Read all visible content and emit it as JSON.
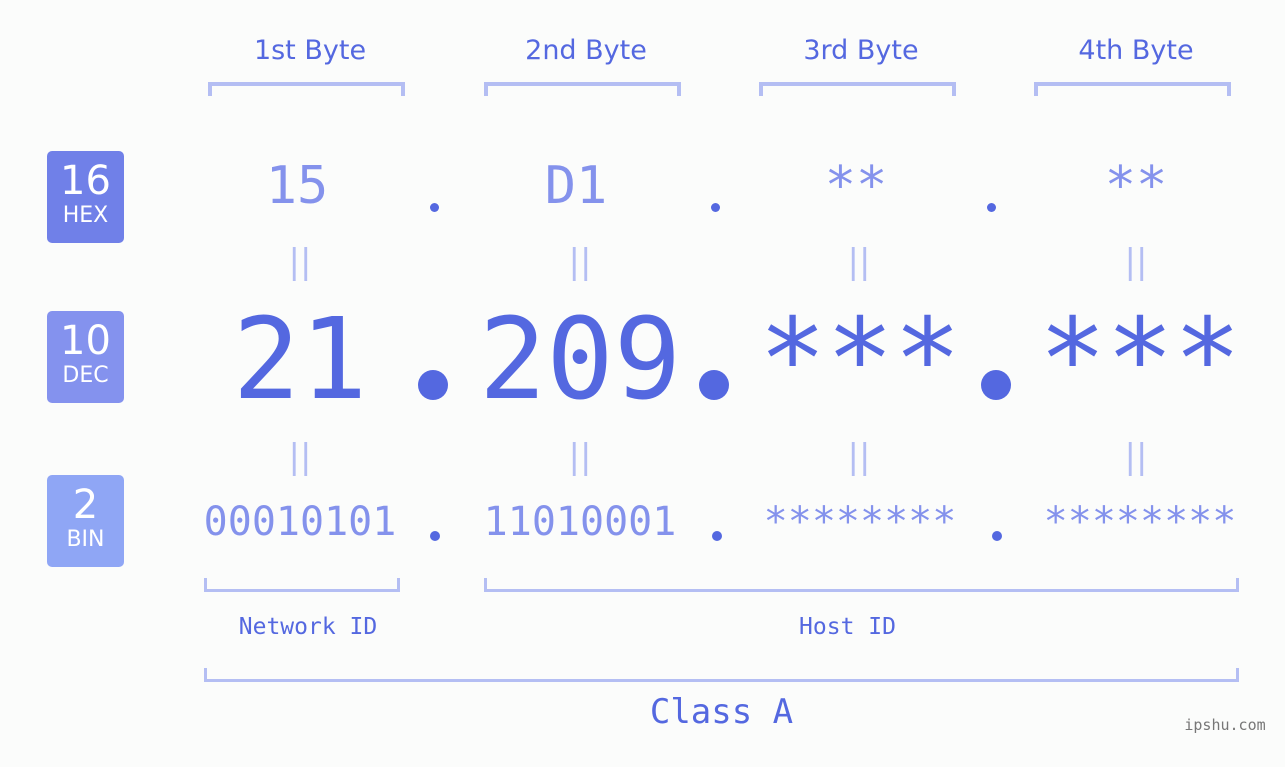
{
  "bases": [
    {
      "number": "16",
      "label": "HEX",
      "color": "#7080e8"
    },
    {
      "number": "10",
      "label": "DEC",
      "color": "#8492ee"
    },
    {
      "number": "2",
      "label": "BIN",
      "color": "#8fa6f5"
    }
  ],
  "byte_headers": [
    "1st Byte",
    "2nd Byte",
    "3rd Byte",
    "4th Byte"
  ],
  "hex": [
    "15",
    "D1",
    "**",
    "**"
  ],
  "dec": [
    "21",
    "209",
    "***",
    "***"
  ],
  "bin": [
    "00010101",
    "11010001",
    "********",
    "********"
  ],
  "equals_symbol": "||",
  "network_id_label": "Network ID",
  "host_id_label": "Host ID",
  "class_label": "Class A",
  "watermark": "ipshu.com",
  "colors": {
    "primary": "#5468e0",
    "light": "#8492ec",
    "bracket": "#b4bef3",
    "background": "#fbfcfb"
  }
}
